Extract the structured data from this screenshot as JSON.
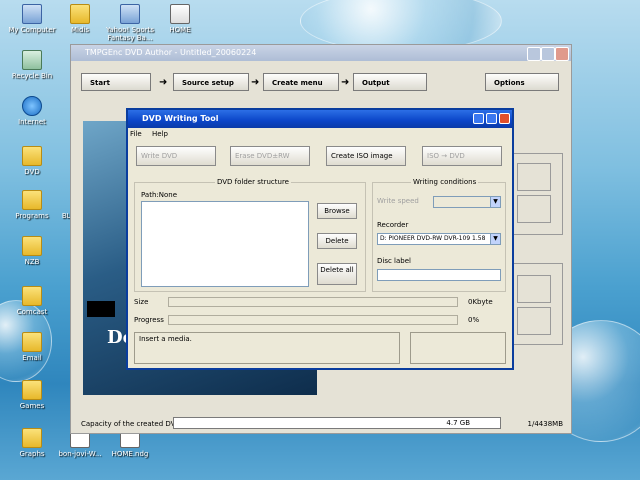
{
  "desktop": {
    "icons": [
      {
        "label": "My Computer",
        "icon": "computer-icon"
      },
      {
        "label": "Midis",
        "icon": "folder-icon"
      },
      {
        "label": "Yahoo! Sports Fantasy Ba...",
        "icon": "shortcut-icon"
      },
      {
        "label": "HOME",
        "icon": "image-file-icon"
      },
      {
        "label": "Recycle Bin",
        "icon": "recycle-bin-icon"
      },
      {
        "label": "We",
        "icon": "shortcut-icon"
      },
      {
        "label": "Internet",
        "icon": "internet-explorer-icon"
      },
      {
        "label": "Doc",
        "icon": "folder-icon"
      },
      {
        "label": "DVD",
        "icon": "folder-icon"
      },
      {
        "label": "Programs",
        "icon": "folder-icon"
      },
      {
        "label": "BLAX 51 S",
        "icon": "folder-icon"
      },
      {
        "label": "NZB",
        "icon": "folder-icon"
      },
      {
        "label": "B",
        "icon": "folder-icon"
      },
      {
        "label": "Comcast",
        "icon": "folder-icon"
      },
      {
        "label": "Bi",
        "icon": "folder-icon"
      },
      {
        "label": "Email",
        "icon": "folder-icon"
      },
      {
        "label": "bonjo",
        "icon": "folder-icon"
      },
      {
        "label": "Games",
        "icon": "folder-icon"
      },
      {
        "label": "mrst",
        "icon": "folder-icon"
      },
      {
        "label": "Graphs",
        "icon": "folder-icon"
      },
      {
        "label": "bon-jovi-W...",
        "icon": "media-file-icon"
      },
      {
        "label": "HOME.ndg",
        "icon": "file-icon"
      }
    ]
  },
  "tmpgenc": {
    "title": "TMPGEnc DVD Author - Untitled_20060224",
    "toolbar": {
      "start": "Start",
      "source_setup": "Source setup",
      "create_menu": "Create menu",
      "output": "Output",
      "options": "Options"
    },
    "capacity_label": "Capacity of the created DVD:",
    "capacity_value": "4.7 GB",
    "capacity_mb": "1/4438MB"
  },
  "dvd_tool": {
    "title": "DVD Writing Tool",
    "menu": [
      "File",
      "Help"
    ],
    "buttons": {
      "write_dvd": "Write DVD",
      "erase_dvd": "Erase DVD±RW",
      "create_iso": "Create ISO image",
      "iso_to_dvd": "ISO → DVD"
    },
    "folder_group": "DVD folder structure",
    "path_label": "Path:None",
    "browse": "Browse",
    "delete": "Delete",
    "delete_all": "Delete all",
    "write_conditions": "Writing conditions",
    "write_speed_label": "Write speed",
    "recorder_label": "Recorder",
    "recorder_value": "D: PIONEER DVD-RW  DVR-109 1.58",
    "disc_label_label": "Disc label",
    "disc_label_value": "",
    "size_label": "Size",
    "size_value": "0Kbyte",
    "progress_label": "Progress",
    "progress_value": "0%",
    "status_message": "Insert a media."
  }
}
